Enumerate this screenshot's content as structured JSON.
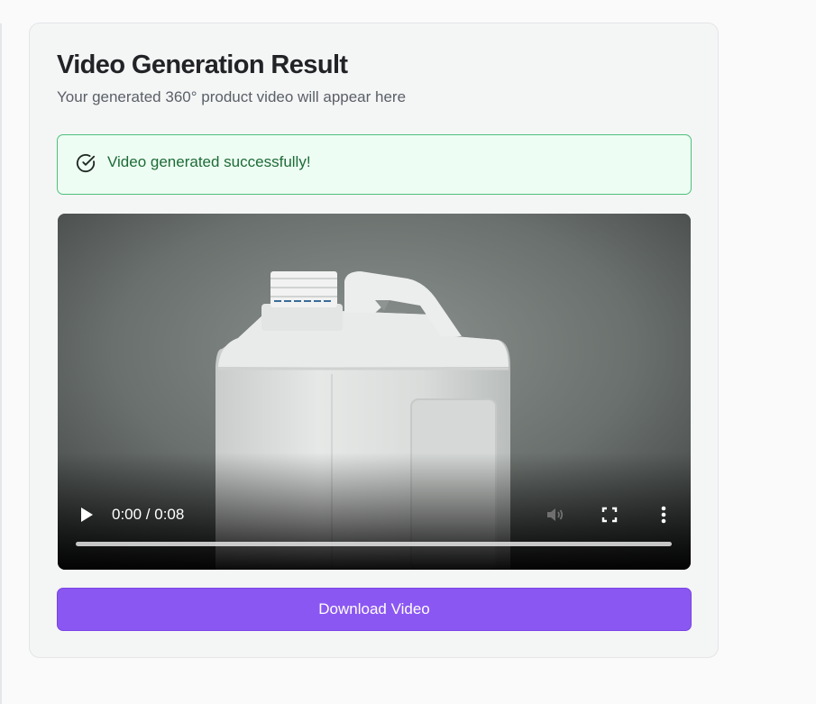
{
  "result": {
    "title": "Video Generation Result",
    "subtitle": "Your generated 360° product video will appear here"
  },
  "alert": {
    "message": "Video generated successfully!",
    "icon": "check-circle-icon",
    "color": "#1d6b37"
  },
  "video": {
    "time": "0:00 / 0:08",
    "progress_fraction": 0
  },
  "actions": {
    "download_label": "Download Video",
    "accent": "#8b57f2"
  }
}
